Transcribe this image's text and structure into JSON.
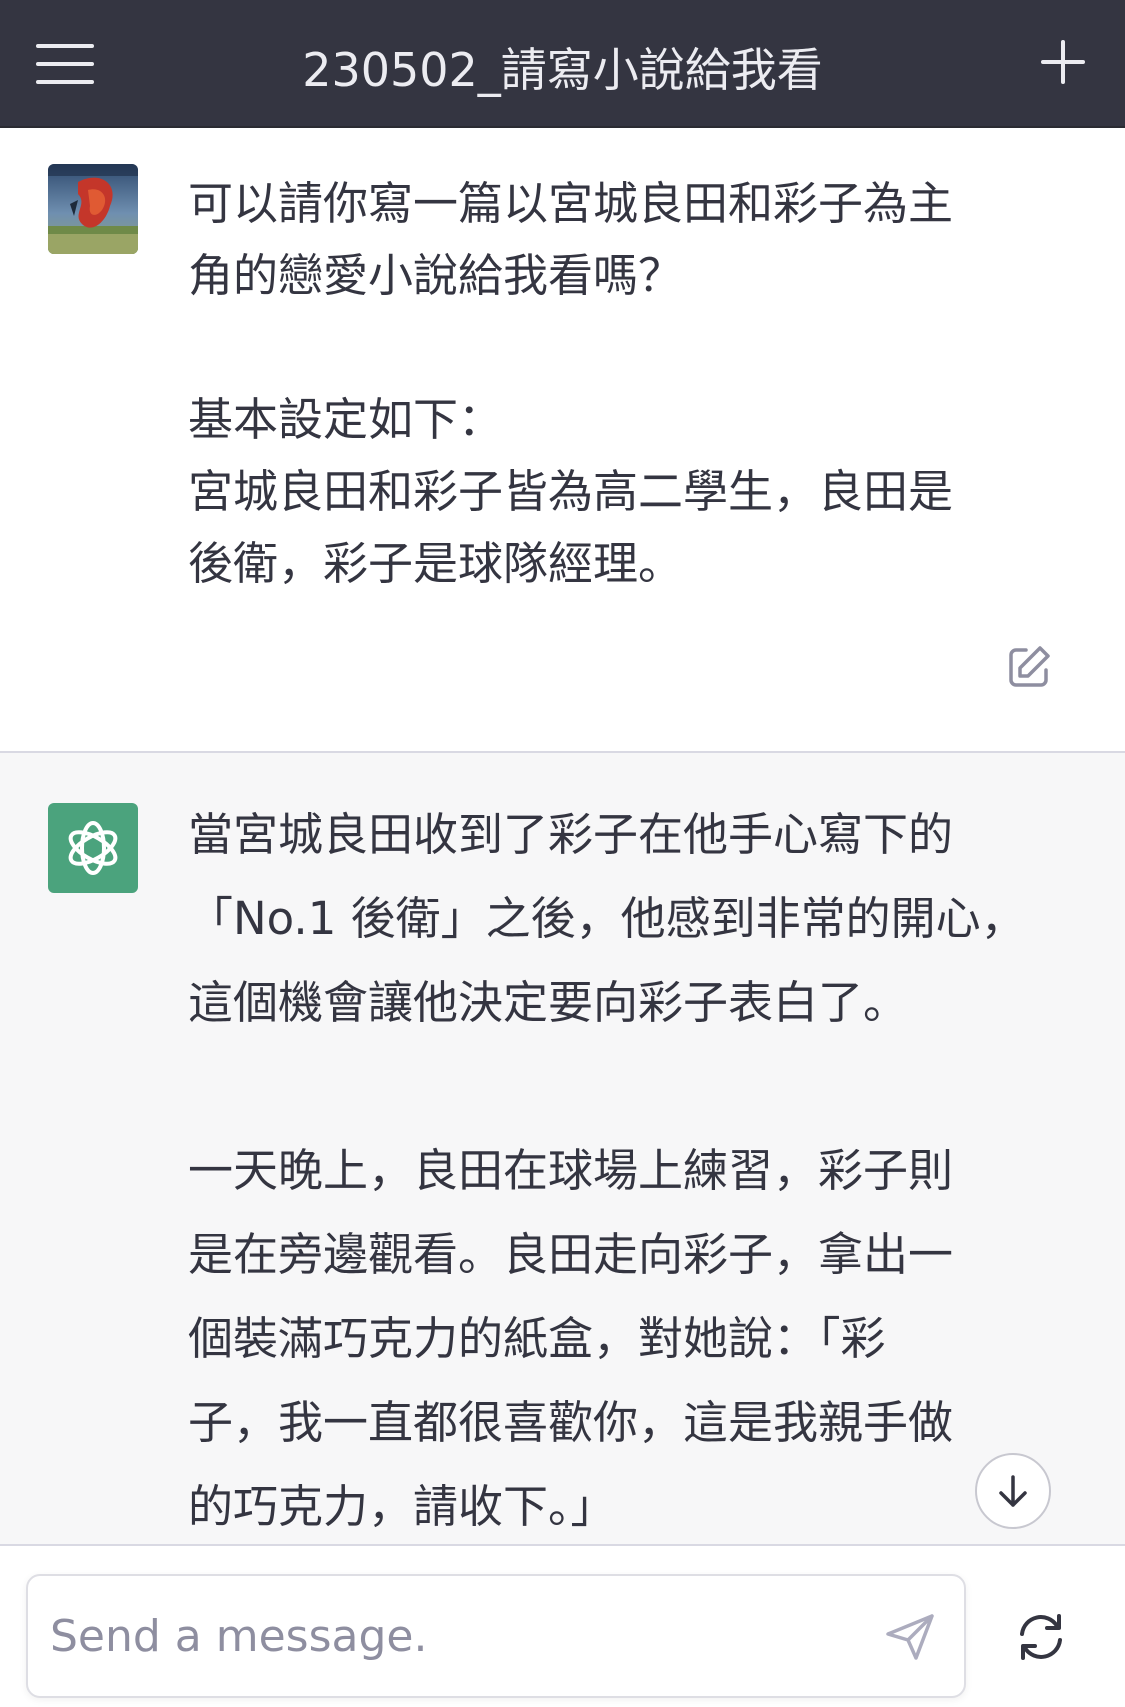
{
  "header": {
    "title": "230502_請寫小說給我看",
    "menu_icon": "hamburger-menu-icon",
    "new_chat_icon": "plus-icon"
  },
  "user_message": {
    "text": "可以請你寫一篇以宮城良田和彩子為主\n角的戀愛小說給我看嗎？\n\n基本設定如下：\n宮城良田和彩子皆為高二學生，良田是\n後衛，彩子是球隊經理。",
    "edit_icon": "edit-icon"
  },
  "assistant_message": {
    "text": "當宮城良田收到了彩子在他手心寫下的\n「No.1 後衛」之後，他感到非常的開心，\n這個機會讓他決定要向彩子表白了。\n\n一天晚上，良田在球場上練習，彩子則\n是在旁邊觀看。良田走向彩子，拿出一\n個裝滿巧克力的紙盒，對她說：「彩\n子，我一直都很喜歡你，這是我親手做\n的巧克力，請收下。」",
    "scroll_icon": "arrow-down-icon"
  },
  "composer": {
    "placeholder": "Send a message.",
    "send_icon": "paper-plane-icon",
    "regenerate_icon": "refresh-icon"
  },
  "colors": {
    "header_bg": "#343541",
    "assistant_avatar": "#4ba37d",
    "assistant_bg": "#f7f7f8"
  }
}
